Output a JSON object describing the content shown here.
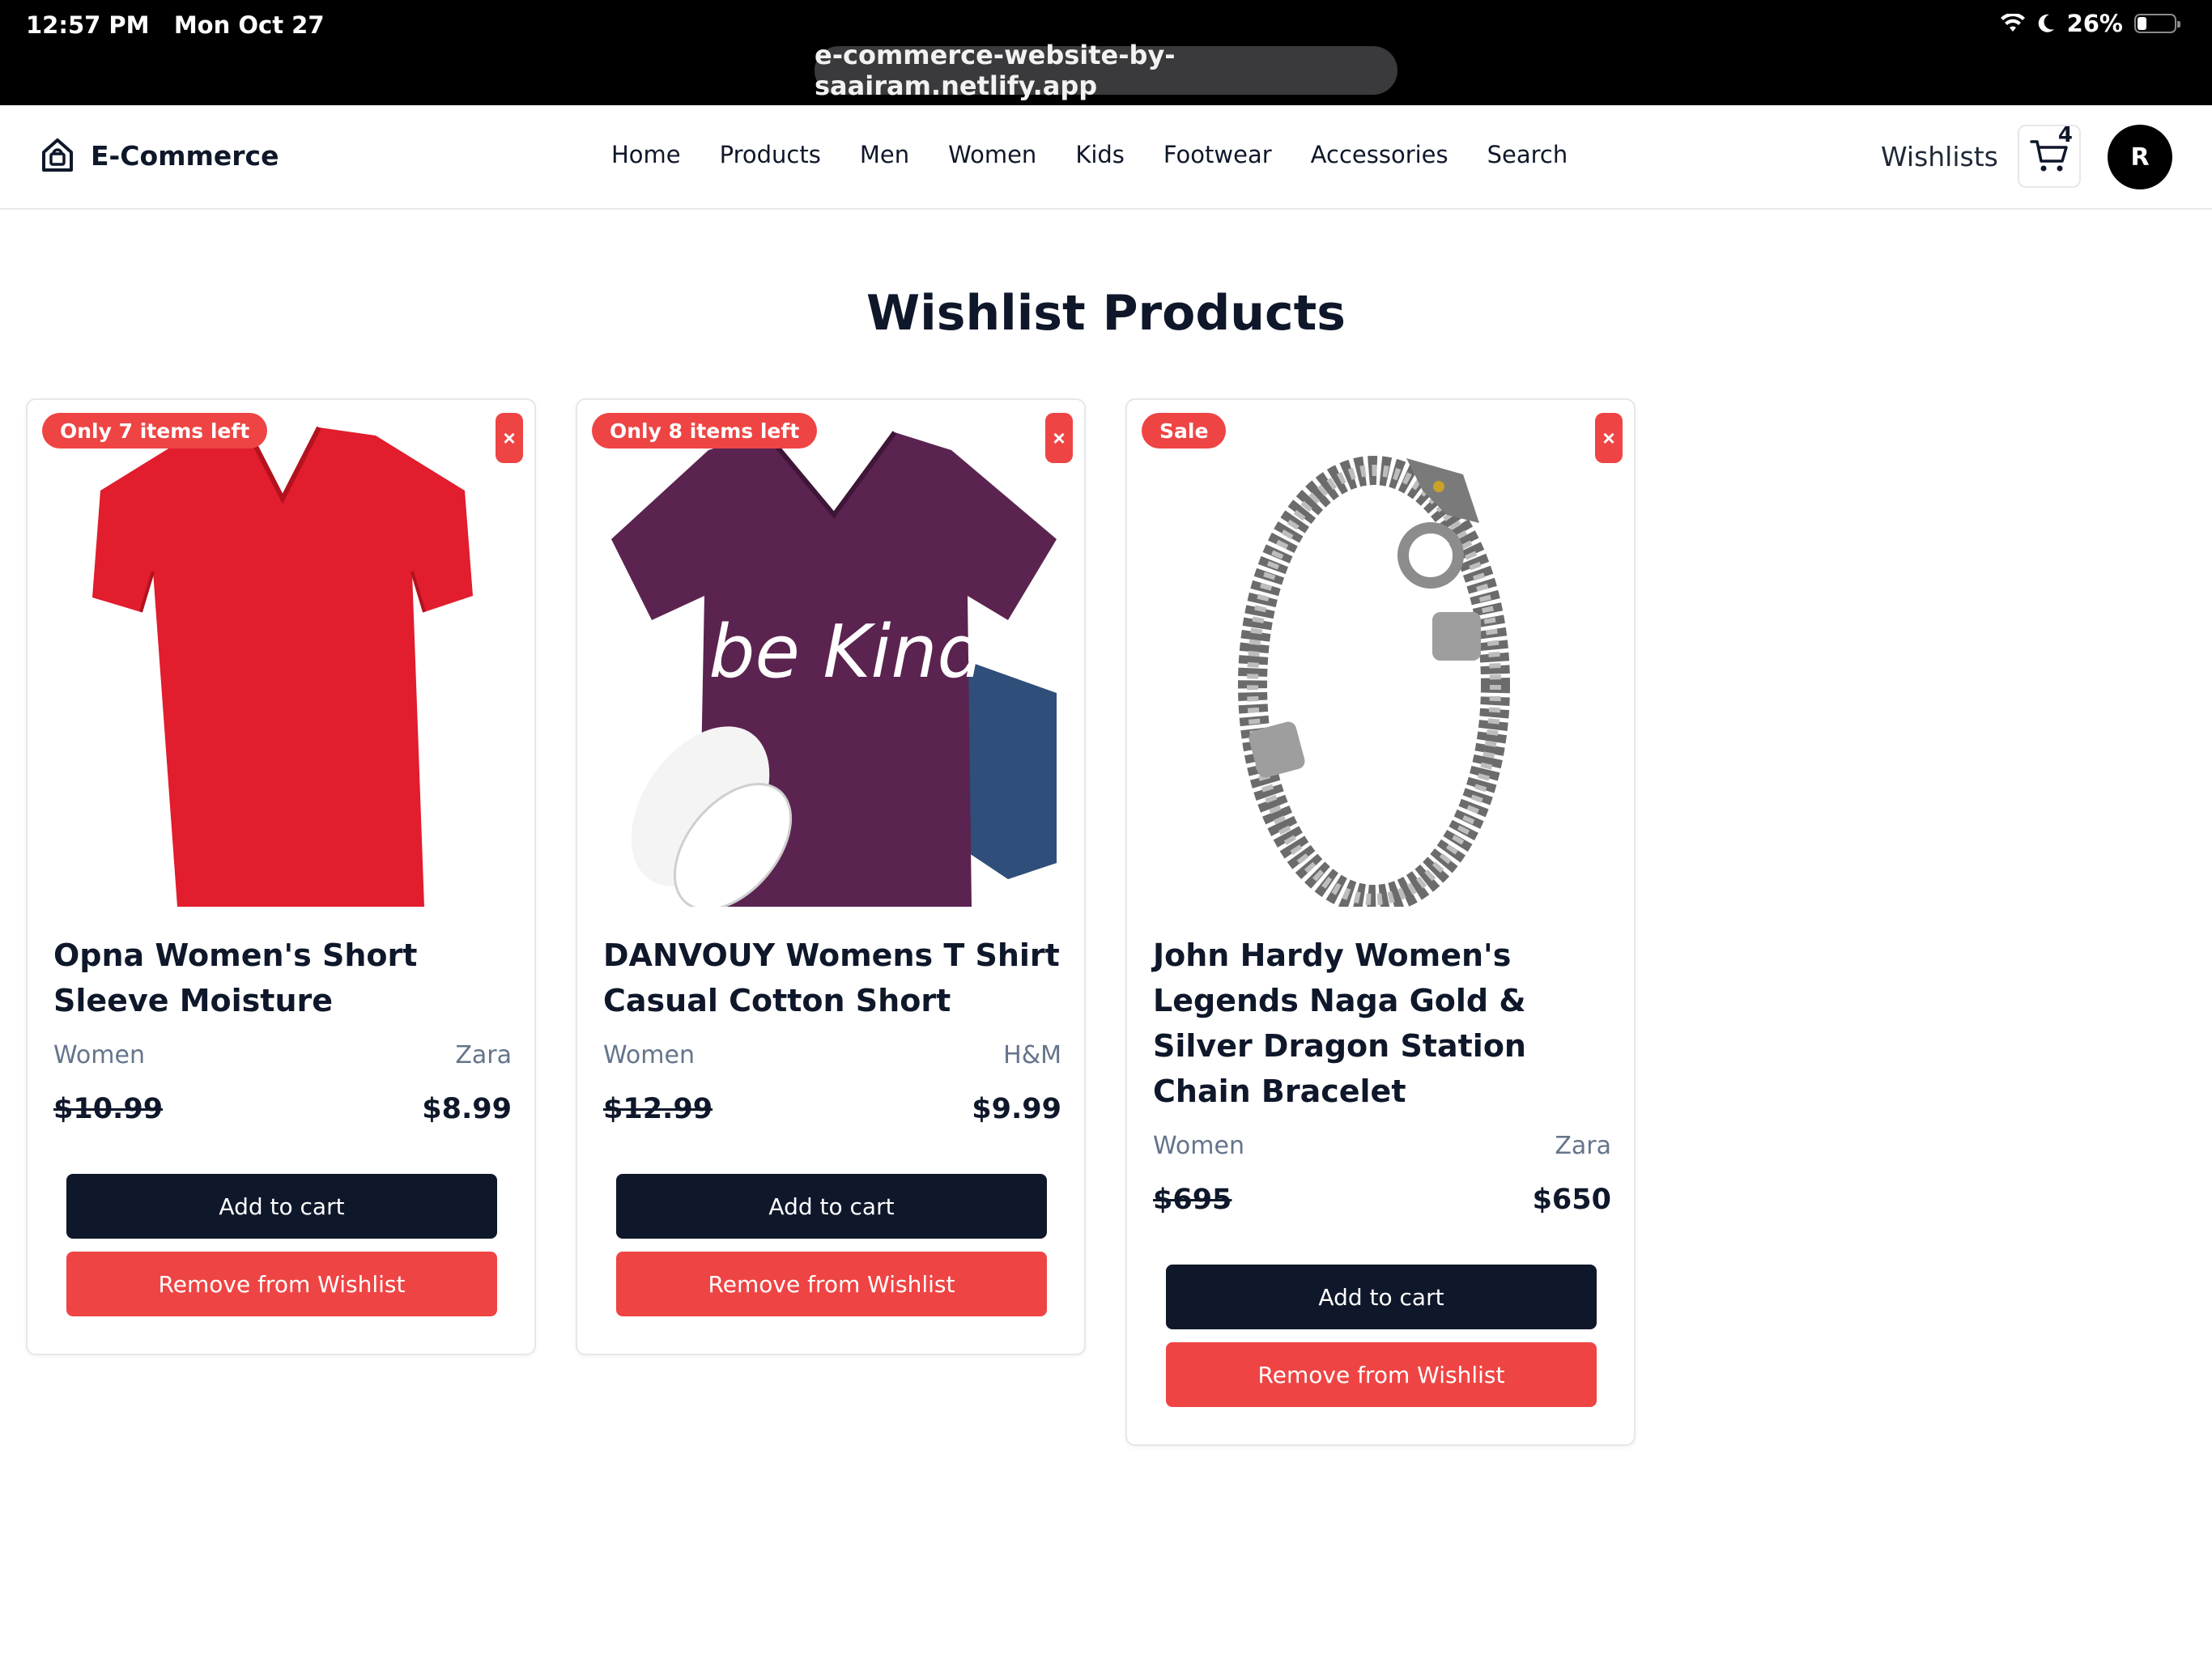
{
  "status_bar": {
    "time": "12:57 PM",
    "date": "Mon Oct 27",
    "battery": "26%",
    "url": "e-commerce-website-by-saairam.netlify.app",
    "icons": [
      "wifi-icon",
      "moon-icon",
      "battery-icon"
    ]
  },
  "navbar": {
    "brand": "E-Commerce",
    "brand_icon": "shopping-bag-home-icon",
    "links": [
      "Home",
      "Products",
      "Men",
      "Women",
      "Kids",
      "Footwear",
      "Accessories",
      "Search"
    ],
    "wishlists": "Wishlists",
    "cart_count": "4",
    "cart_icon": "cart-icon",
    "avatar_initial": "R"
  },
  "page": {
    "title": "Wishlist Products"
  },
  "products": [
    {
      "badge": "Only 7 items left",
      "title": "Opna Women's Short Sleeve Moisture",
      "category": "Women",
      "brand": "Zara",
      "old_price": "$10.99",
      "price": "$8.99",
      "add_to_cart": "Add to cart",
      "remove": "Remove from Wishlist",
      "remove_icon": "×",
      "image": "red-vneck-tshirt"
    },
    {
      "badge": "Only 8 items left",
      "title": "DANVOUY Womens T Shirt Casual Cotton Short",
      "category": "Women",
      "brand": "H&M",
      "old_price": "$12.99",
      "price": "$9.99",
      "add_to_cart": "Add to cart",
      "remove": "Remove from Wishlist",
      "remove_icon": "×",
      "image": "purple-be-kind-tshirt",
      "image_text": "be Kind"
    },
    {
      "badge": "Sale",
      "title": "John Hardy Women's Legends Naga Gold & Silver Dragon Station Chain Bracelet",
      "category": "Women",
      "brand": "Zara",
      "old_price": "$695",
      "price": "$650",
      "add_to_cart": "Add to cart",
      "remove": "Remove from Wishlist",
      "remove_icon": "×",
      "image": "silver-dragon-bracelet"
    }
  ],
  "colors": {
    "accent_red": "#ef4444",
    "dark_navy": "#0f172a",
    "muted_text": "#64748b"
  }
}
